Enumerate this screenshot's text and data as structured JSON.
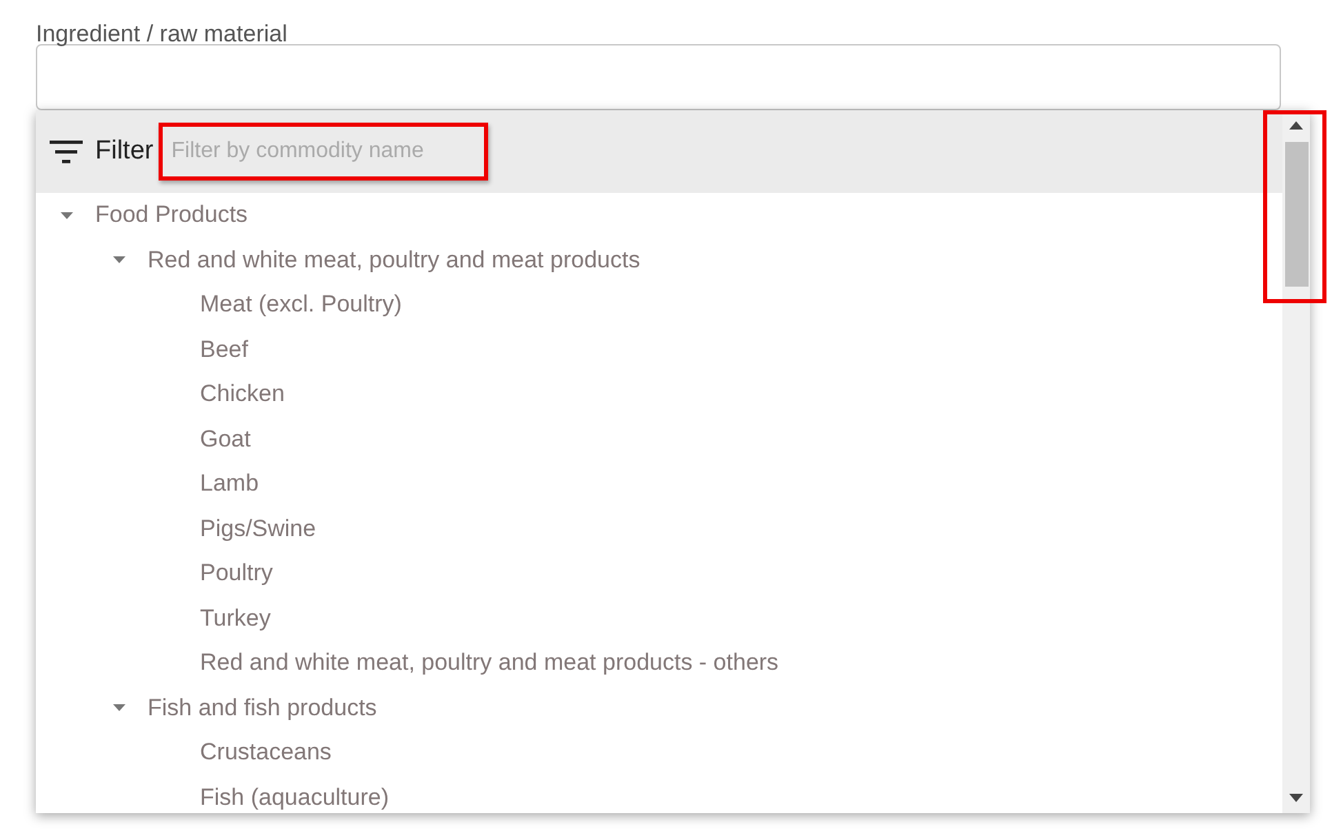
{
  "field": {
    "label": "Ingredient / raw material"
  },
  "filter": {
    "label": "Filter",
    "placeholder": "Filter by commodity name"
  },
  "tree": [
    {
      "label": "Food Products",
      "expanded": true,
      "children": [
        {
          "label": "Red and white meat, poultry and meat products",
          "expanded": true,
          "children": [
            {
              "label": "Meat (excl. Poultry)"
            },
            {
              "label": "Beef"
            },
            {
              "label": "Chicken"
            },
            {
              "label": "Goat"
            },
            {
              "label": "Lamb"
            },
            {
              "label": "Pigs/Swine"
            },
            {
              "label": "Poultry"
            },
            {
              "label": "Turkey"
            },
            {
              "label": "Red and white meat, poultry and meat products - others"
            }
          ]
        },
        {
          "label": "Fish and fish products",
          "expanded": true,
          "children": [
            {
              "label": "Crustaceans"
            },
            {
              "label": "Fish (aquaculture)"
            }
          ]
        }
      ]
    }
  ]
}
